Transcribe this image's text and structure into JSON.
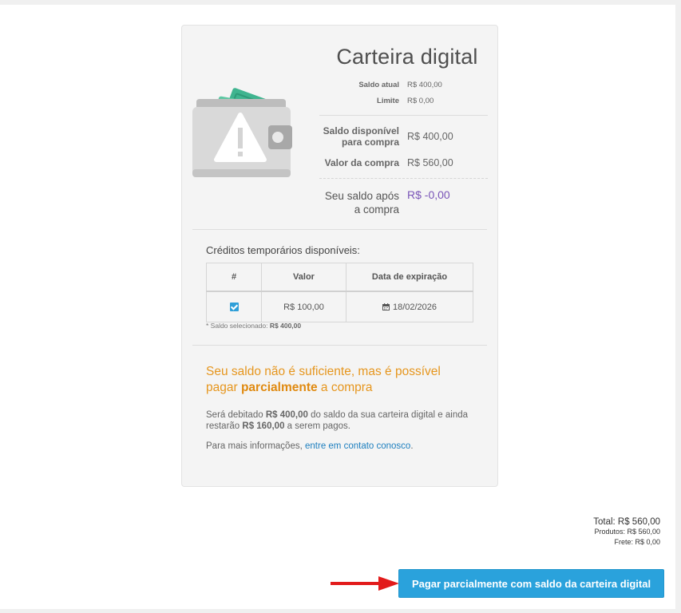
{
  "wallet": {
    "title": "Carteira digital",
    "saldo_atual_label": "Saldo atual",
    "saldo_atual_value": "R$ 400,00",
    "limite_label": "Limite",
    "limite_value": "R$ 0,00",
    "saldo_disponivel_label": "Saldo disponível para compra",
    "saldo_disponivel_value": "R$ 400,00",
    "valor_compra_label": "Valor da compra",
    "valor_compra_value": "R$ 560,00",
    "saldo_apos_label": "Seu saldo após a compra",
    "saldo_apos_value": "R$ -0,00",
    "colors": {
      "accent_purple": "#7a55b8",
      "warning": "#e6961e",
      "link": "#1d7fbf"
    }
  },
  "credits": {
    "title": "Créditos temporários disponíveis:",
    "headers": [
      "#",
      "Valor",
      "Data de expiração"
    ],
    "rows": [
      {
        "checked": true,
        "valor": "R$ 100,00",
        "data": "18/02/2026"
      }
    ],
    "note_prefix": "* Saldo selecionado:",
    "note_value": "R$ 400,00"
  },
  "warning": {
    "line_prefix": "Seu saldo não é suficiente, mas é possível pagar",
    "line_bold": "parcialmente",
    "line_suffix": "a compra"
  },
  "debit": {
    "t1": "Será debitado",
    "amount1": "R$ 400,00",
    "t2": "do saldo da sua carteira digital e ainda restarão",
    "amount2": "R$ 160,00",
    "t3": "a serem pagos."
  },
  "info": {
    "prefix": "Para mais informações,",
    "link": "entre em contato conosco",
    "suffix": "."
  },
  "totals": {
    "total": "Total: R$ 560,00",
    "produtos": "Produtos: R$ 560,00",
    "frete": "Frete: R$ 0,00"
  },
  "actions": {
    "pay_button": "Pagar parcialmente com saldo da carteira digital"
  }
}
